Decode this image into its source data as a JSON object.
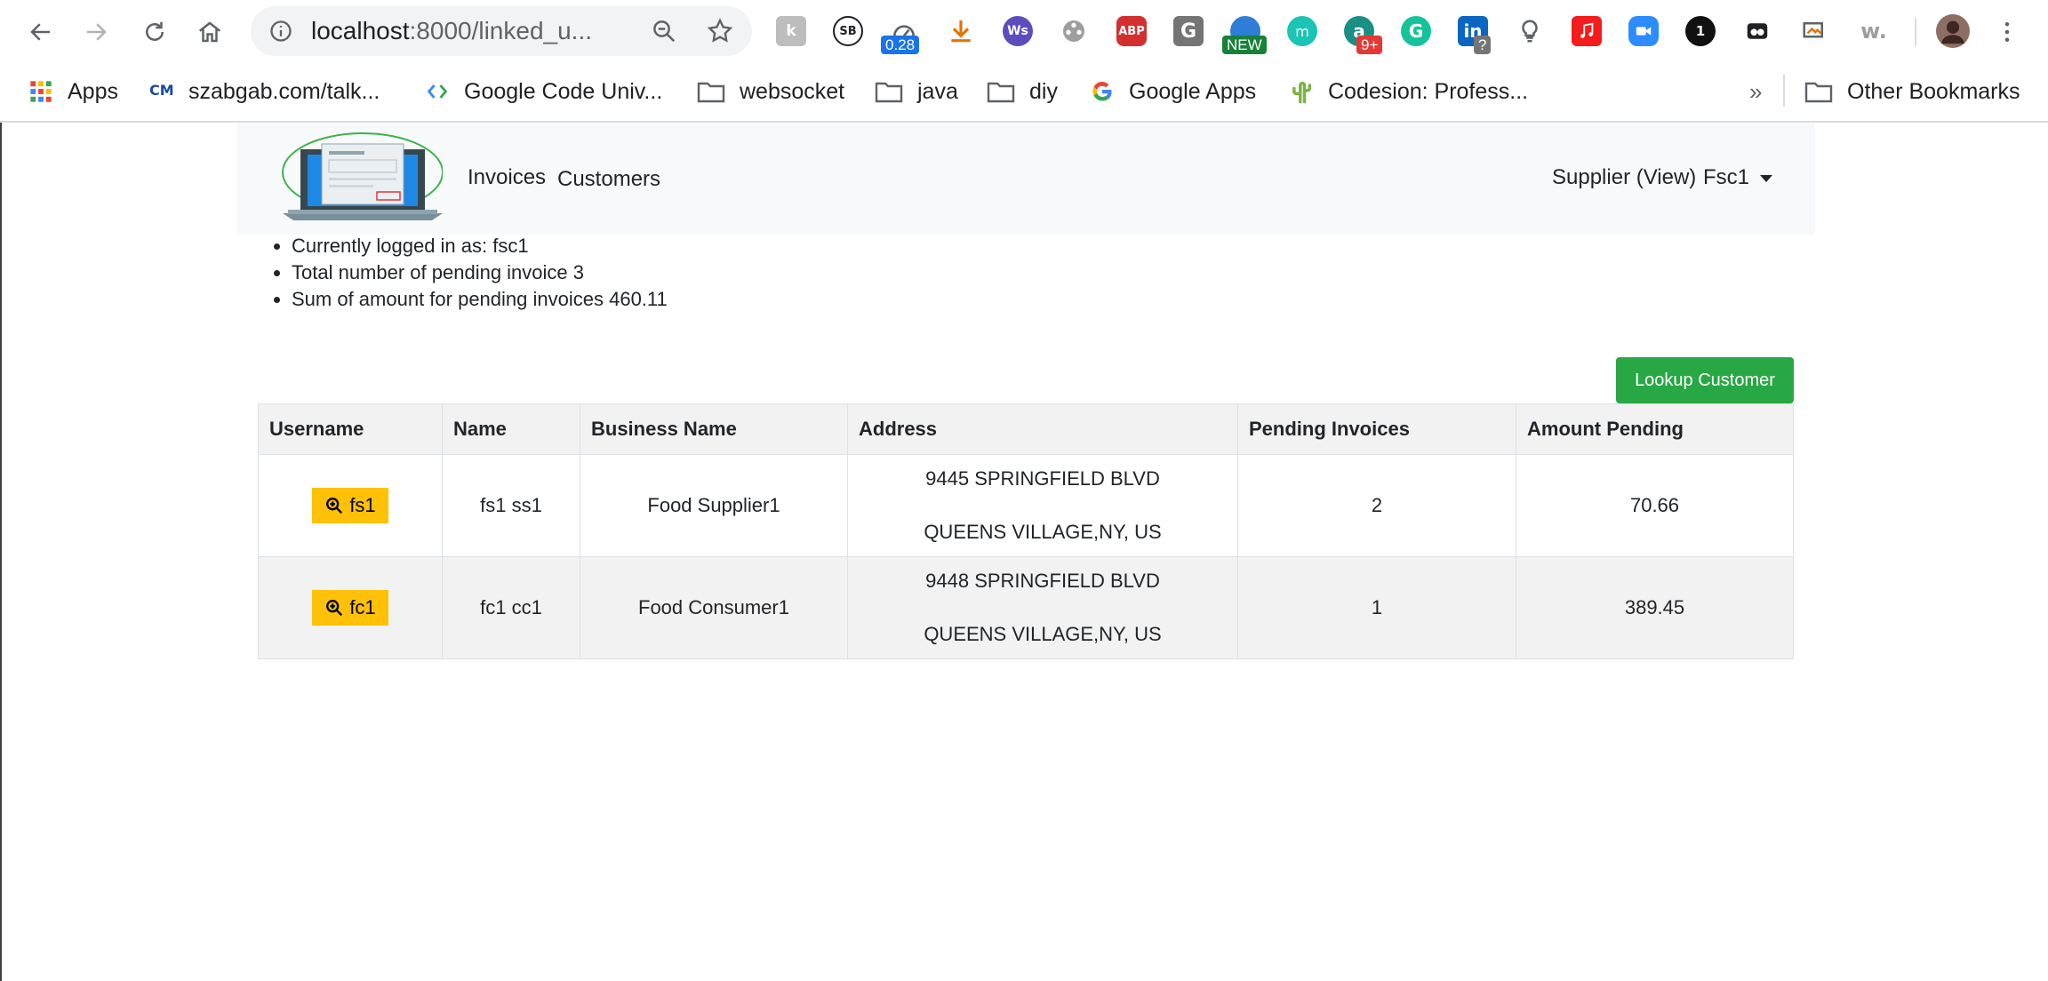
{
  "browser": {
    "url_host": "localhost",
    "url_rest": ":8000/linked_u...",
    "extension_badges": {
      "speed": "0.28",
      "new": "NEW",
      "count": "9+",
      "question": "?"
    },
    "extension_labels": {
      "abp": "ABP",
      "g": "G",
      "w": "w.",
      "one": "1",
      "k": "k",
      "sb": "SB"
    },
    "bookmarks": [
      {
        "label": "Apps"
      },
      {
        "label": "szabgab.com/talk..."
      },
      {
        "label": "Google Code Univ..."
      },
      {
        "label": "websocket"
      },
      {
        "label": "java"
      },
      {
        "label": "diy"
      },
      {
        "label": "Google Apps"
      },
      {
        "label": "Codesion: Profess..."
      }
    ],
    "bookmarks_overflow": "»",
    "other_bookmarks": "Other Bookmarks"
  },
  "nav": {
    "links": [
      "Invoices",
      "Customers"
    ],
    "user_role": "Supplier (View)",
    "user_name": "Fsc1"
  },
  "summary": [
    "Currently logged in as: fsc1",
    "Total number of pending invoice 3",
    "Sum of amount for pending invoices 460.11"
  ],
  "lookup_button": "Lookup Customer",
  "table": {
    "headers": [
      "Username",
      "Name",
      "Business Name",
      "Address",
      "Pending Invoices",
      "Amount Pending"
    ],
    "rows": [
      {
        "username": "fs1",
        "name": "fs1 ss1",
        "business": "Food Supplier1",
        "address_line1": "9445 SPRINGFIELD BLVD",
        "address_line2": "QUEENS VILLAGE,NY, US",
        "pending": "2",
        "amount": "70.66"
      },
      {
        "username": "fc1",
        "name": "fc1 cc1",
        "business": "Food Consumer1",
        "address_line1": "9448 SPRINGFIELD BLVD",
        "address_line2": "QUEENS VILLAGE,NY, US",
        "pending": "1",
        "amount": "389.45"
      }
    ]
  },
  "colors": {
    "lookup_button": "#28a745",
    "user_button": "#ffc107",
    "navbar_bg": "#f8f9fa",
    "row_stripe": "#f2f2f2"
  }
}
